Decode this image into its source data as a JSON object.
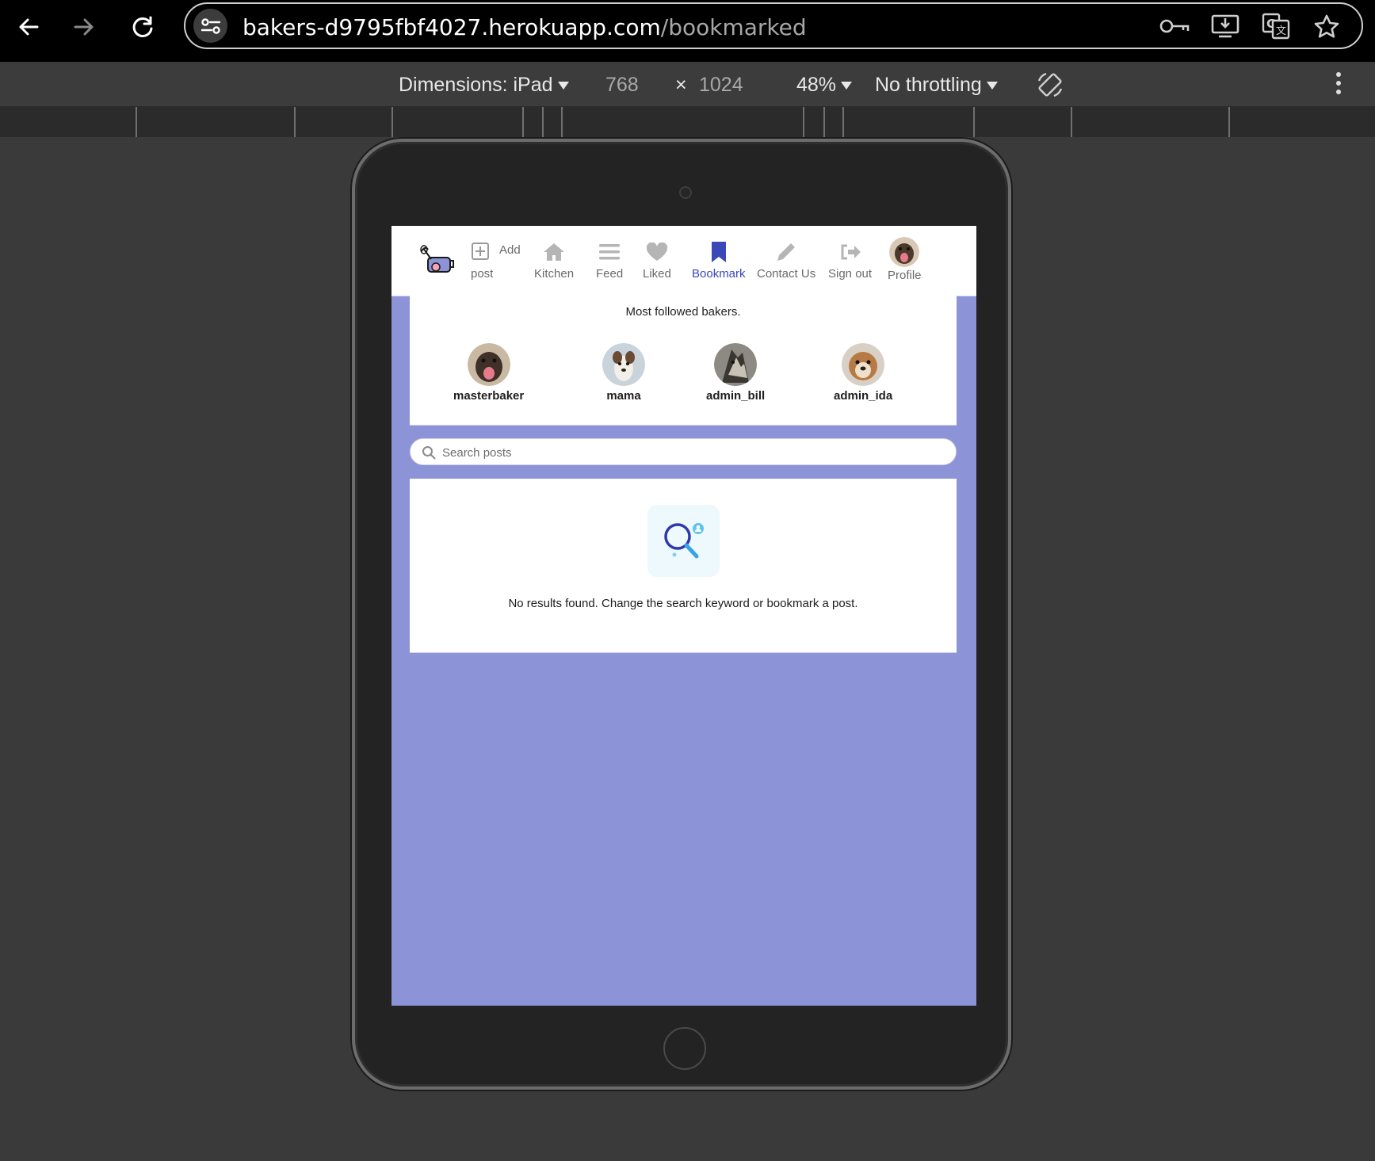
{
  "browser": {
    "url_host": "bakers-d9795fbf4027.herokuapp.com",
    "url_path": "/bookmarked",
    "back_icon": "back-arrow-icon",
    "forward_icon": "forward-arrow-icon",
    "reload_icon": "reload-icon"
  },
  "device_toolbar": {
    "dimensions_label": "Dimensions: iPad",
    "width": "768",
    "times": "×",
    "height": "1024",
    "zoom": "48%",
    "throttling": "No throttling"
  },
  "app": {
    "nav": {
      "add_post_line1": "Add",
      "add_post_line2": "post",
      "items": [
        {
          "label": "Kitchen",
          "icon": "home-icon"
        },
        {
          "label": "Feed",
          "icon": "feed-icon"
        },
        {
          "label": "Liked",
          "icon": "heart-icon"
        },
        {
          "label": "Bookmark",
          "icon": "bookmark-icon",
          "active": true
        },
        {
          "label": "Contact Us",
          "icon": "pencil-icon"
        },
        {
          "label": "Sign out",
          "icon": "sign-out-icon"
        },
        {
          "label": "Profile",
          "icon": "avatar"
        }
      ],
      "active_color": "#3a48b8"
    },
    "followed": {
      "title": "Most followed bakers.",
      "bakers": [
        {
          "name": "masterbaker"
        },
        {
          "name": "mama"
        },
        {
          "name": "admin_bill"
        },
        {
          "name": "admin_ida"
        }
      ]
    },
    "search": {
      "placeholder": "Search posts",
      "value": ""
    },
    "results": {
      "empty_message": "No results found. Change the search keyword or bookmark a post."
    },
    "colors": {
      "background": "#8c93d6",
      "accent": "#3a48b8"
    }
  }
}
